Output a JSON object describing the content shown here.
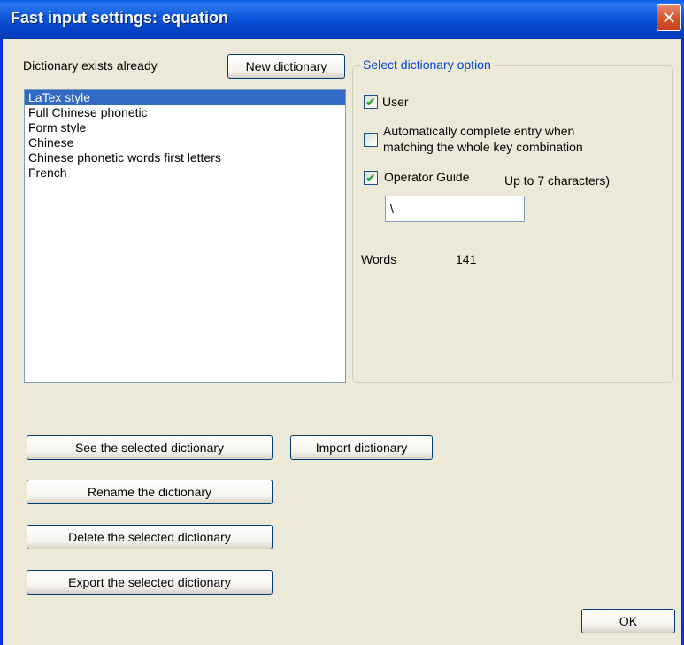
{
  "window": {
    "title": "Fast input settings: equation",
    "close_symbol": "✕"
  },
  "dictionary": {
    "exists_label": "Dictionary exists already",
    "new_button": "New dictionary",
    "items": [
      "LaTex style",
      "Full Chinese phonetic",
      "Form style",
      "Chinese",
      "Chinese phonetic words first letters",
      "French"
    ],
    "selected_index": 0
  },
  "options": {
    "group_title": "Select dictionary option",
    "user_label": "User",
    "user_checked": true,
    "autocomplete_label_line1": "Automatically complete entry when",
    "autocomplete_label_line2": "matching the whole key combination",
    "autocomplete_checked": false,
    "operator_guide_label": "Operator Guide",
    "operator_guide_checked": true,
    "operator_guide_hint": "Up to 7 characters)",
    "operator_guide_value": "\\",
    "words_label": "Words",
    "words_count": "141"
  },
  "actions": {
    "see_selected": "See the selected dictionary",
    "import": "Import dictionary",
    "rename": "Rename the dictionary",
    "delete_selected": "Delete the selected dictionary",
    "export_selected": "Export the selected dictionary",
    "ok": "OK"
  },
  "colors": {
    "titlebar": "#0b55d9",
    "selection": "#316ac5",
    "group_title": "#0046d5",
    "close": "#d6552e"
  }
}
